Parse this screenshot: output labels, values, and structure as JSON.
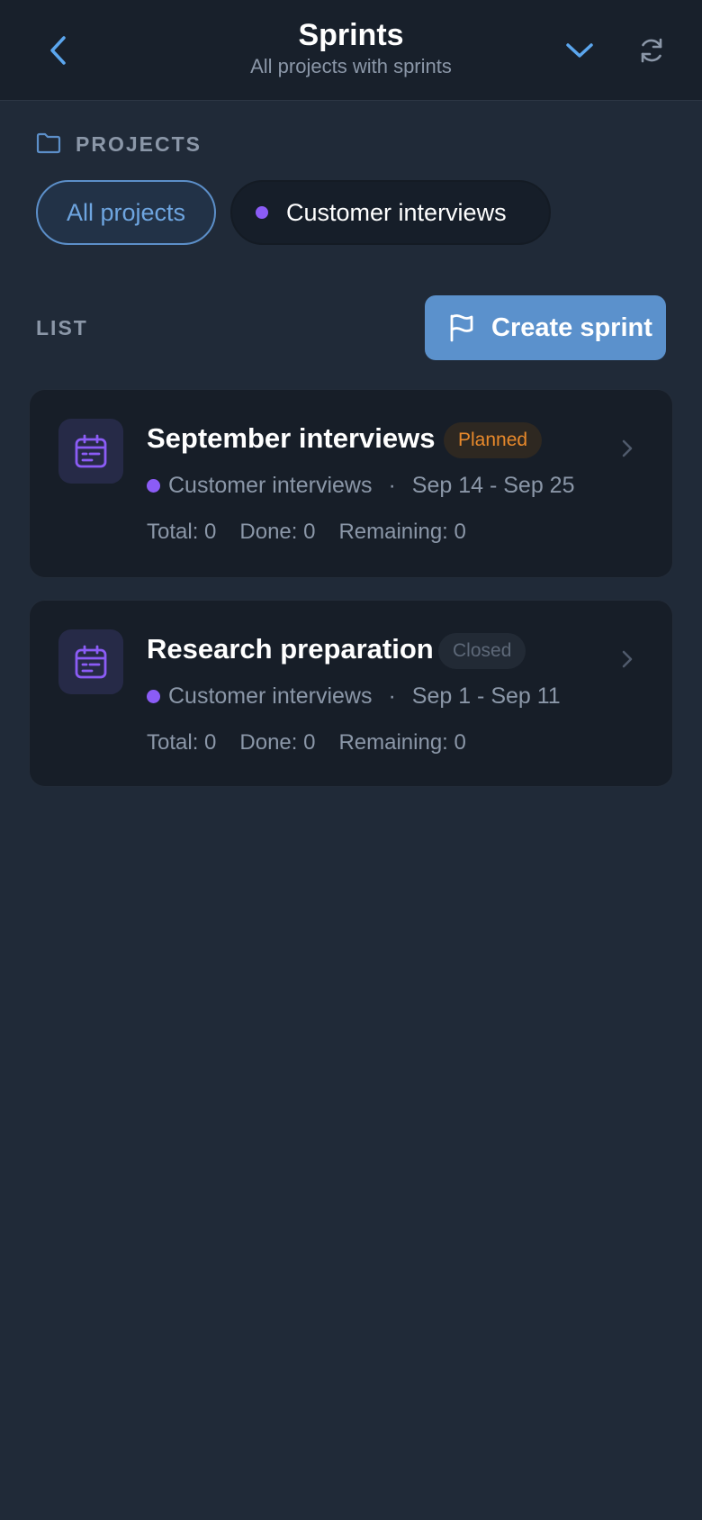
{
  "header": {
    "title": "Sprints",
    "subtitle": "All projects with sprints"
  },
  "projects": {
    "label": "PROJECTS",
    "chips": [
      {
        "label": "All projects",
        "selected": true
      },
      {
        "label": "Customer interviews",
        "color": "#8b5cf6"
      }
    ]
  },
  "list": {
    "label": "LIST",
    "create_label": "Create sprint"
  },
  "sprints": [
    {
      "name": "September interviews",
      "status": "Planned",
      "project": "Customer interviews",
      "sep": "·",
      "dates": "Sep 14 - Sep 25",
      "total": "Total: 0",
      "done": "Done: 0",
      "remaining": "Remaining: 0"
    },
    {
      "name": "Research preparation",
      "status": "Closed",
      "project": "Customer interviews",
      "sep": "·",
      "dates": "Sep 1 - Sep 11",
      "total": "Total: 0",
      "done": "Done: 0",
      "remaining": "Remaining: 0"
    }
  ],
  "colors": {
    "accent": "#5b91cc",
    "project": "#8b5cf6",
    "planned": "#e8892b"
  }
}
